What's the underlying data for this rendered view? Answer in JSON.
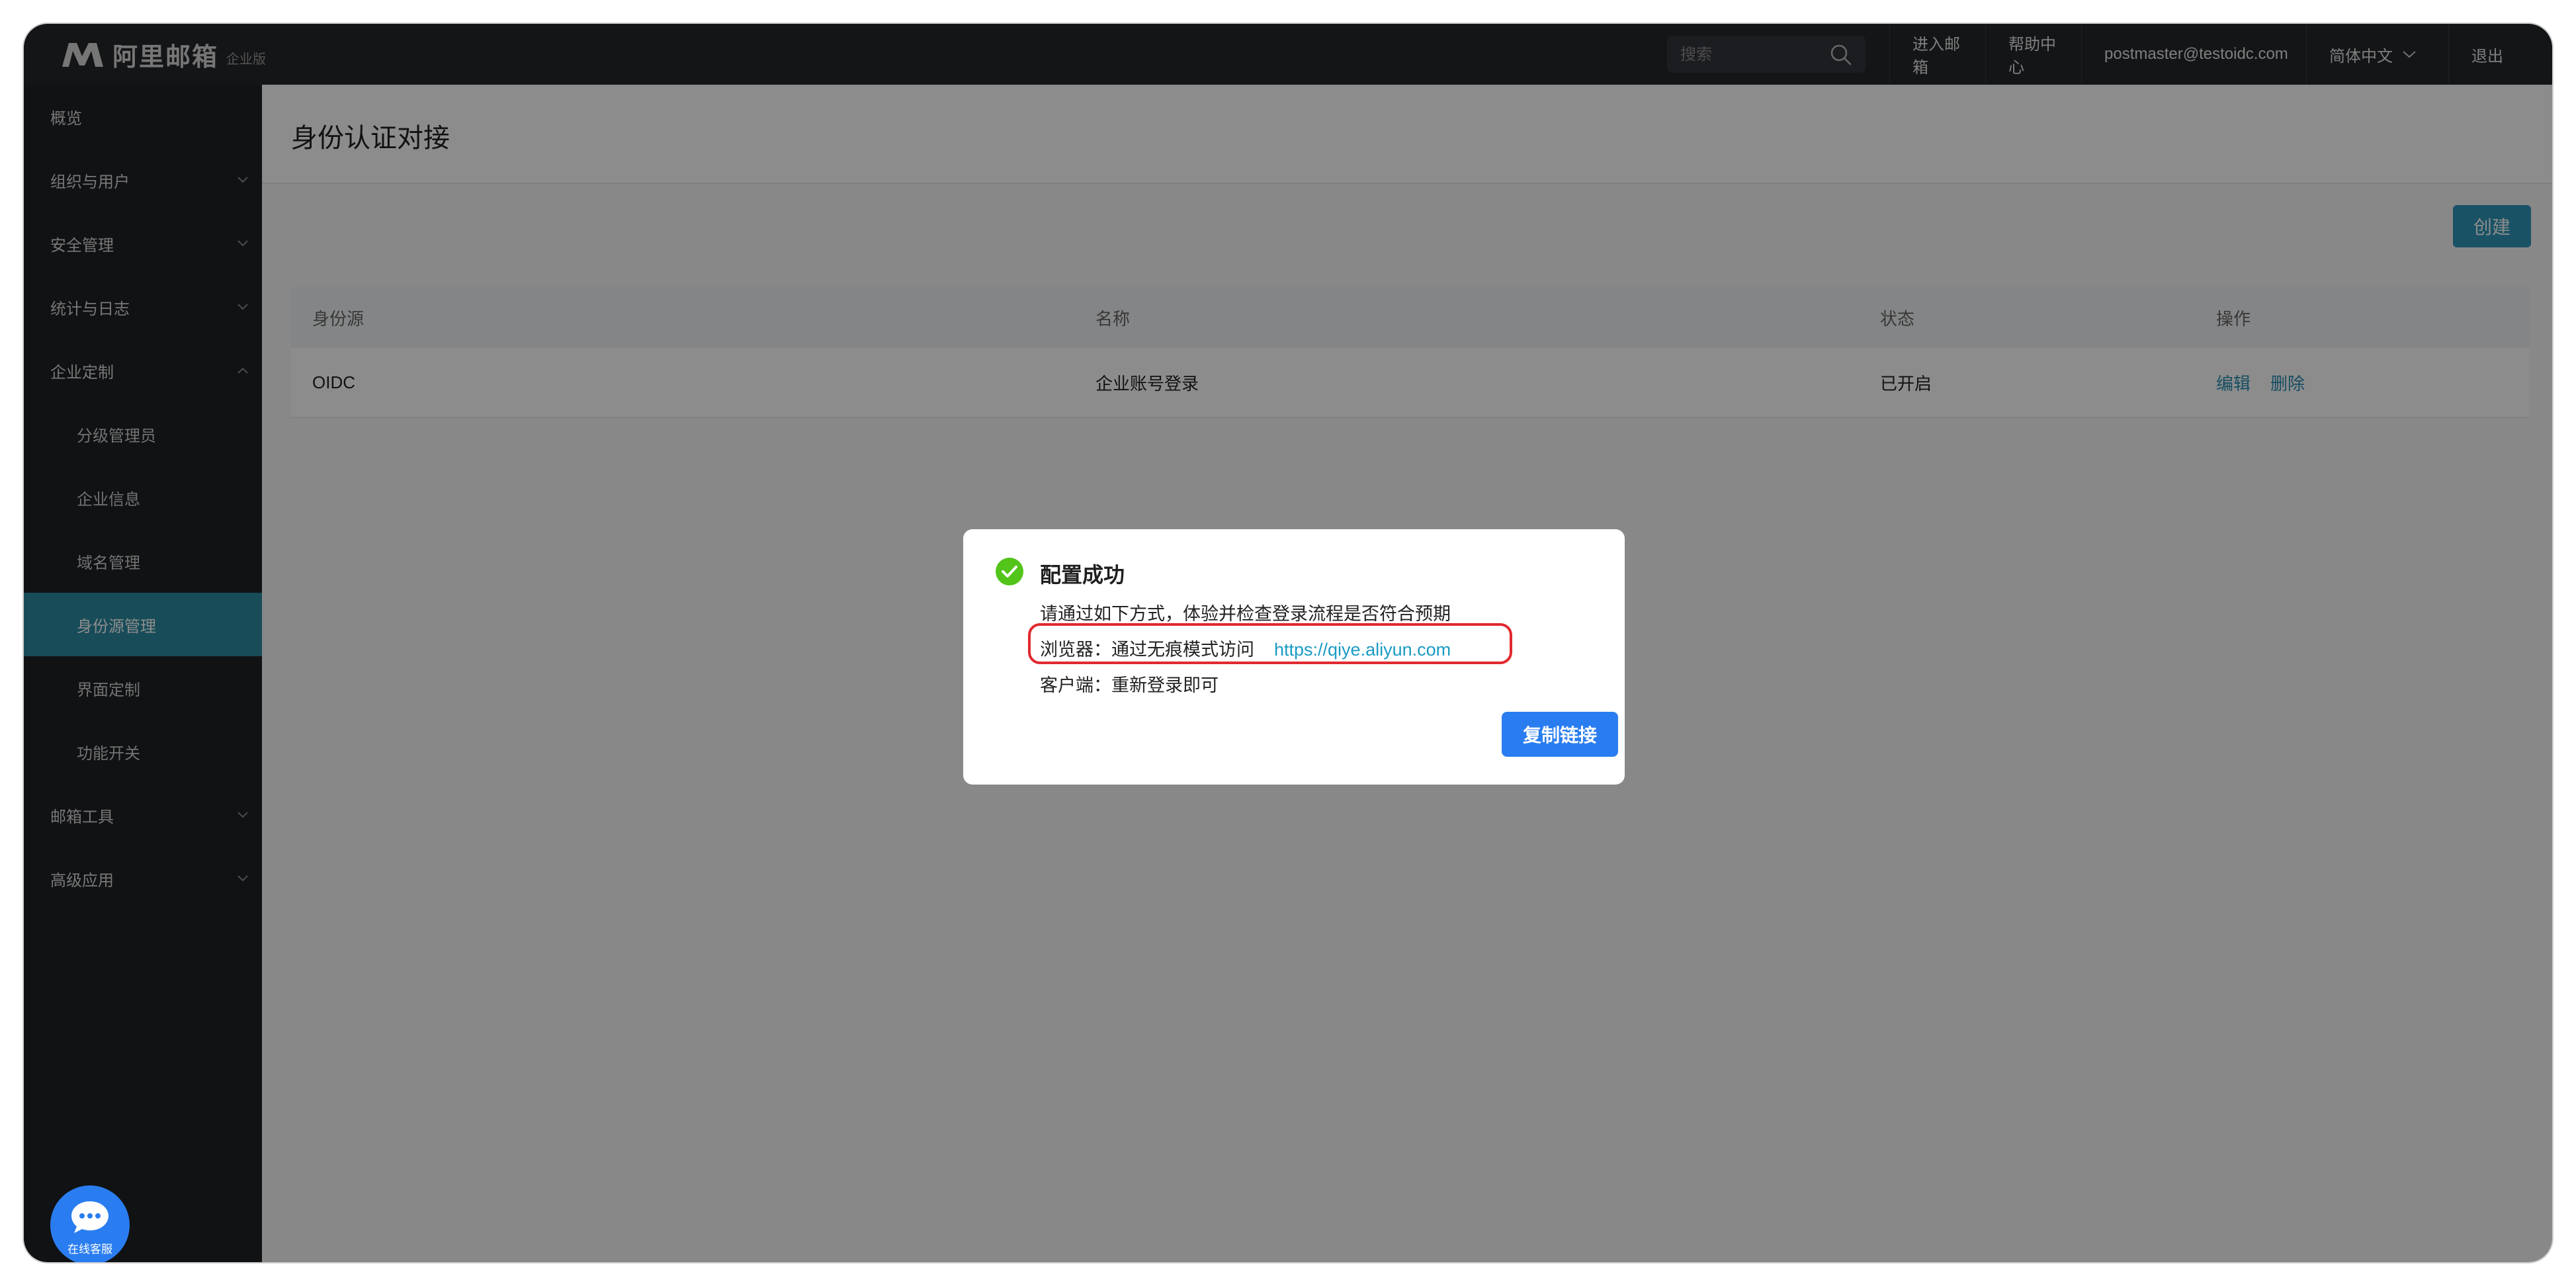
{
  "brand": {
    "name": "阿里邮箱",
    "edition": "企业版"
  },
  "topbar": {
    "search_placeholder": "搜索",
    "enter_mailbox": "进入邮箱",
    "help_center": "帮助中心",
    "user_email": "postmaster@testoidc.com",
    "language": "简体中文",
    "logout": "退出"
  },
  "sidebar": {
    "items": [
      {
        "label": "概览"
      },
      {
        "label": "组织与用户"
      },
      {
        "label": "安全管理"
      },
      {
        "label": "统计与日志"
      },
      {
        "label": "企业定制"
      },
      {
        "label": "分级管理员"
      },
      {
        "label": "企业信息"
      },
      {
        "label": "域名管理"
      },
      {
        "label": "身份源管理"
      },
      {
        "label": "界面定制"
      },
      {
        "label": "功能开关"
      },
      {
        "label": "邮箱工具"
      },
      {
        "label": "高级应用"
      }
    ]
  },
  "main": {
    "page_title": "身份认证对接",
    "create_button": "创建",
    "table": {
      "headers": [
        "身份源",
        "名称",
        "状态",
        "操作"
      ],
      "rows": [
        {
          "source": "OIDC",
          "name": "企业账号登录",
          "status": "已开启",
          "edit": "编辑",
          "delete": "删除"
        }
      ]
    }
  },
  "modal": {
    "title": "配置成功",
    "line1": "请通过如下方式，体验并检查登录流程是否符合预期",
    "browser_label": "浏览器：通过无痕模式访问",
    "browser_url": "https://qiye.aliyun.com",
    "client_line": "客户端：重新登录即可",
    "copy_button": "复制链接"
  },
  "chat": {
    "label": "在线客服"
  },
  "colors": {
    "topbar": "#25272b",
    "sidebar": "#1f2125",
    "active_nav": "#2c8aa3",
    "primary_button": "#2a7df0",
    "link": "#2a8fb5",
    "success": "#52c41a",
    "highlight_border": "#e0292f"
  }
}
